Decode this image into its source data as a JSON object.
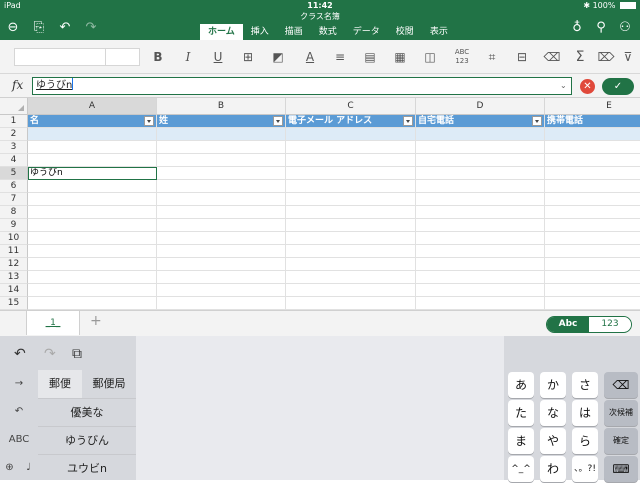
{
  "status": {
    "device": "iPad",
    "time": "11:42",
    "battery": "100%"
  },
  "document": {
    "title": "クラス名簿"
  },
  "ribbon_tabs": [
    "ホーム",
    "挿入",
    "描画",
    "数式",
    "データ",
    "校閲",
    "表示"
  ],
  "toolbar": {
    "bold": "B",
    "italic": "I",
    "underline": "U",
    "font_color_label": "A",
    "spell_label": "ABC\n123",
    "sum_label": "Σ"
  },
  "formula": {
    "fx_label": "fx",
    "value": "ゆうびn"
  },
  "columns": [
    "A",
    "B",
    "C",
    "D",
    "E"
  ],
  "rows": [
    "1",
    "2",
    "3",
    "4",
    "5",
    "6",
    "7",
    "8",
    "9",
    "10",
    "11",
    "12",
    "13",
    "14",
    "15"
  ],
  "header_row": [
    "名",
    "姓",
    "電子メール アドレス",
    "自宅電話",
    "携帯電話"
  ],
  "active_cell": {
    "ref": "A5",
    "value": "ゆうびn"
  },
  "sheet": {
    "tab_label": "_1_",
    "add_label": "+"
  },
  "format_toggle": {
    "text": "Abc",
    "number": "123"
  },
  "keyboard": {
    "candidates_top": [
      "郵便",
      "郵便局"
    ],
    "candidates": [
      "優美な",
      "ゆうびん",
      "ユウビn"
    ],
    "side": {
      "abc": "ABC"
    },
    "keys": [
      "あ",
      "か",
      "さ",
      "た",
      "な",
      "は",
      "ま",
      "や",
      "ら",
      "^_^",
      "わ",
      "、。?!"
    ],
    "fn": {
      "next": "次候補",
      "confirm": "確定"
    }
  },
  "colors": {
    "accent": "#217346",
    "table_header": "#5b9bd5",
    "band": "#ddebf7"
  }
}
